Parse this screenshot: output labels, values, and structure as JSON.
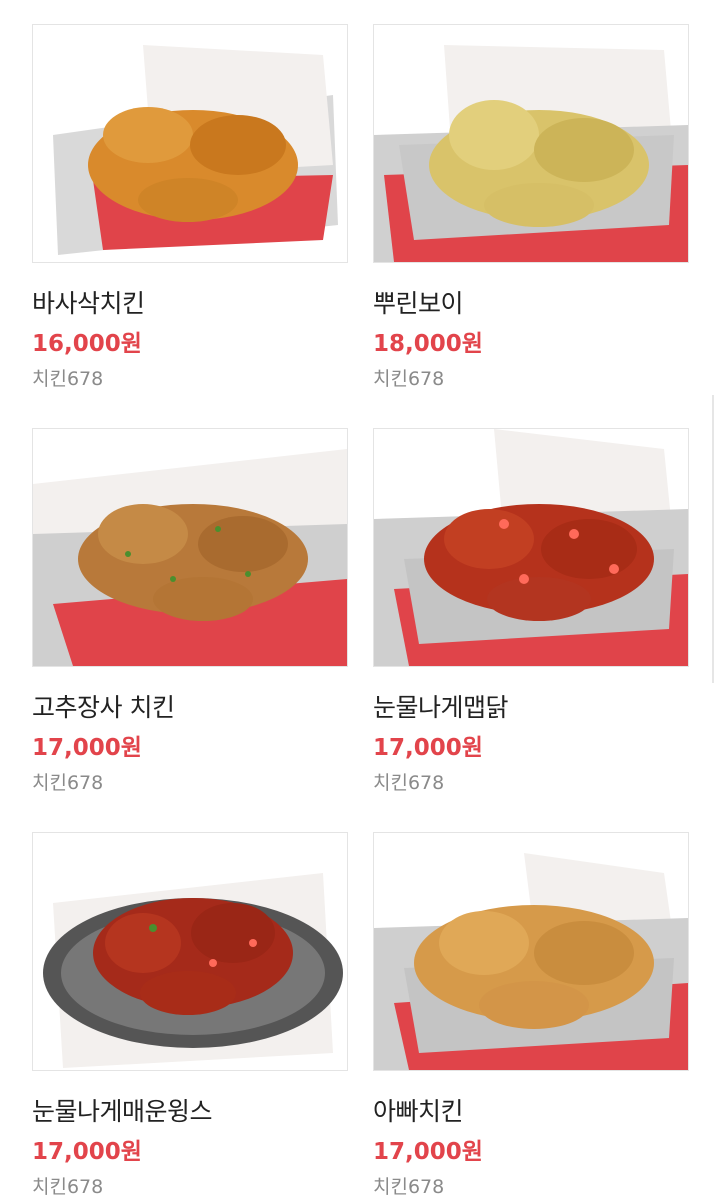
{
  "products": [
    {
      "name": "바사삭치킨",
      "price": "16,000원",
      "store": "치킨678",
      "image_icon": "fried-chicken-tray-image",
      "chicken_color": "#d98a2c",
      "tray_color": "#e0444a"
    },
    {
      "name": "뿌린보이",
      "price": "18,000원",
      "store": "치킨678",
      "image_icon": "seasoned-chicken-tray-image",
      "chicken_color": "#d9c36a",
      "tray_color": "#e0444a"
    },
    {
      "name": "고추장사 치킨",
      "price": "17,000원",
      "store": "치킨678",
      "image_icon": "pepper-chicken-tray-image",
      "chicken_color": "#b8793a",
      "tray_color": "#e0444a"
    },
    {
      "name": "눈물나게맵닭",
      "price": "17,000원",
      "store": "치킨678",
      "image_icon": "spicy-chicken-tray-image",
      "chicken_color": "#b5321c",
      "tray_color": "#e0444a"
    },
    {
      "name": "눈물나게매운윙스",
      "price": "17,000원",
      "store": "치킨678",
      "image_icon": "spicy-wings-plate-image",
      "chicken_color": "#a52a1a",
      "tray_color": "#555555"
    },
    {
      "name": "아빠치킨",
      "price": "17,000원",
      "store": "치킨678",
      "image_icon": "crispy-chicken-tray-image",
      "chicken_color": "#d69a4a",
      "tray_color": "#e0444a"
    }
  ]
}
